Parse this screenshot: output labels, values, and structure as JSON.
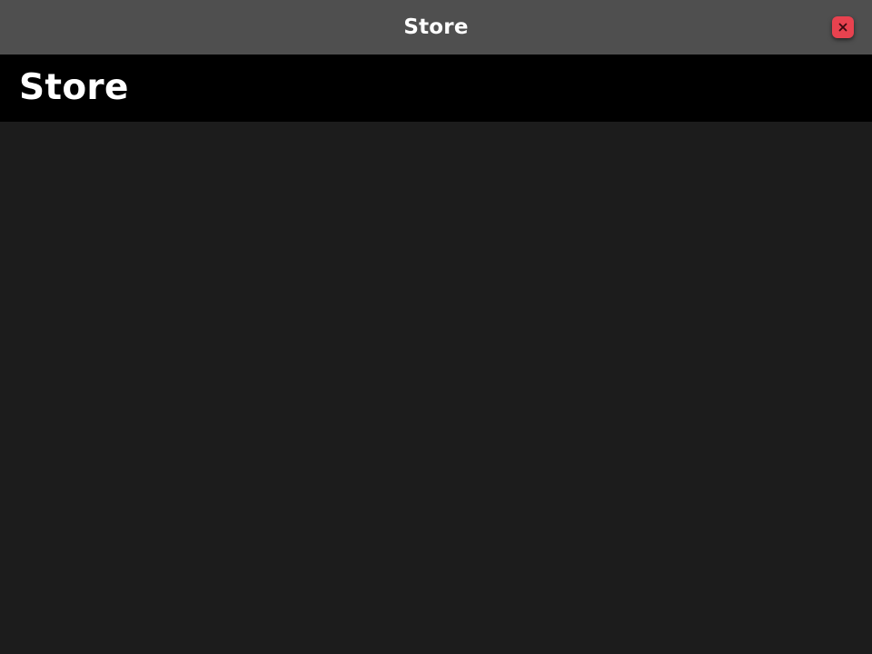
{
  "window": {
    "title": "Store",
    "close_icon": "close-icon",
    "colors": {
      "titlebar_bg": "#4f4f4f",
      "close_button_bg": "#e8424f"
    }
  },
  "header": {
    "title": "Store",
    "background": "#000000"
  },
  "main": {
    "background": "#1c1c1c",
    "items": []
  }
}
